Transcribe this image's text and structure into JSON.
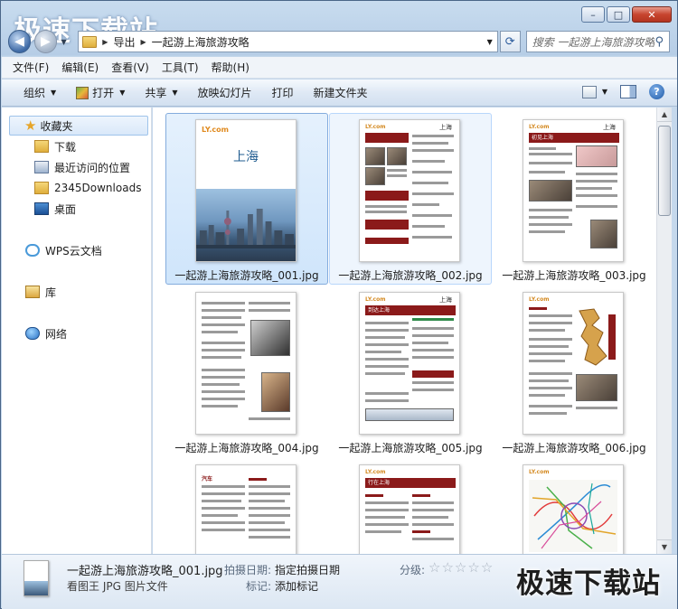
{
  "window": {
    "caption": {
      "minimize": "–",
      "maximize": "□",
      "close": "✕"
    }
  },
  "watermark": {
    "top": "极速下载站",
    "bottom": "极速下载站"
  },
  "nav": {
    "breadcrumb": [
      "导出",
      "一起游上海旅游攻略"
    ],
    "search_placeholder": "搜索 一起游上海旅游攻略"
  },
  "menu": [
    "文件(F)",
    "编辑(E)",
    "查看(V)",
    "工具(T)",
    "帮助(H)"
  ],
  "toolbar": {
    "organize": "组织",
    "open": "打开",
    "share": "共享",
    "slideshow": "放映幻灯片",
    "print": "打印",
    "new_folder": "新建文件夹"
  },
  "sidebar": {
    "favorites": "收藏夹",
    "downloads": "下载",
    "recent": "最近访问的位置",
    "downloads_2345": "2345Downloads",
    "desktop": "桌面",
    "wps": "WPS云文档",
    "libraries": "库",
    "network": "网络"
  },
  "files": [
    "一起游上海旅游攻略_001.jpg",
    "一起游上海旅游攻略_002.jpg",
    "一起游上海旅游攻略_003.jpg",
    "一起游上海旅游攻略_004.jpg",
    "一起游上海旅游攻略_005.jpg",
    "一起游上海旅游攻略_006.jpg"
  ],
  "thumbs": {
    "cover_logo": "LY.com",
    "cover_title": "上海",
    "page_place": "上海",
    "p3_title": "初见上海",
    "p5_title": "到达上海",
    "p8_title": "行在上海",
    "p7_title": "汽车"
  },
  "status": {
    "filename": "一起游上海旅游攻略_001.jpg",
    "type": "看图王 JPG 图片文件",
    "date_label": "拍摄日期:",
    "date_value": "指定拍摄日期",
    "tag_label": "标记:",
    "tag_value": "添加标记",
    "rating_label": "分级:",
    "rating": 0
  }
}
